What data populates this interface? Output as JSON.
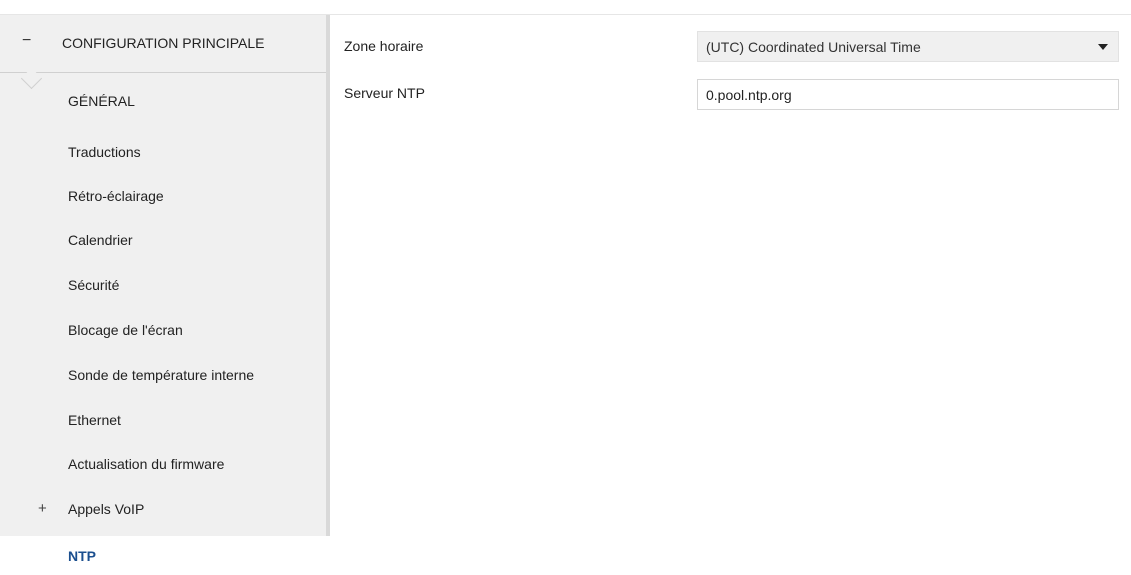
{
  "sidebar": {
    "header": {
      "toggle_symbol": "−",
      "label": "CONFIGURATION PRINCIPALE"
    },
    "items": [
      {
        "label": "GÉNÉRAL"
      },
      {
        "label": "Traductions"
      },
      {
        "label": "Rétro-éclairage"
      },
      {
        "label": "Calendrier"
      },
      {
        "label": "Sécurité"
      },
      {
        "label": "Blocage de l'écran"
      },
      {
        "label": "Sonde de température interne"
      },
      {
        "label": "Ethernet"
      },
      {
        "label": "Actualisation du firmware"
      },
      {
        "label": "Appels VoIP",
        "expand_symbol": "+"
      }
    ],
    "active_item": {
      "label": "NTP"
    }
  },
  "main": {
    "timezone": {
      "label": "Zone horaire",
      "value": "(UTC) Coordinated Universal Time"
    },
    "ntp_server": {
      "label": "Serveur NTP",
      "value": "0.pool.ntp.org"
    }
  },
  "colors": {
    "sidebar_bg": "#f0f0f0",
    "active_text": "#1b4f8f",
    "border": "#d9d9d9"
  }
}
